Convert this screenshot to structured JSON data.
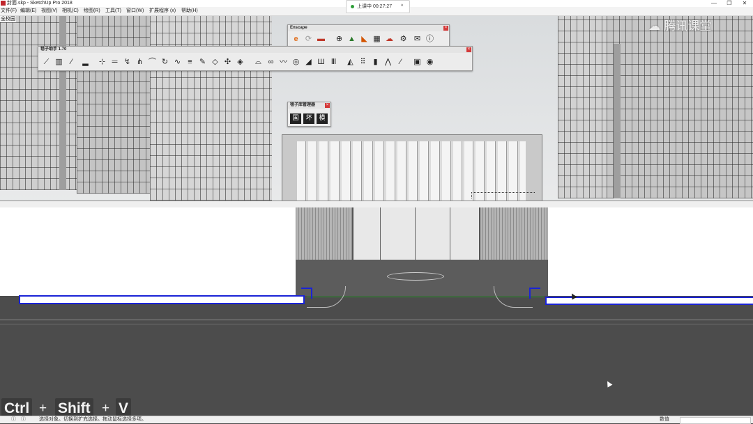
{
  "window": {
    "title": "封面.skp - SketchUp Pro 2018",
    "controls": [
      "—",
      "❐",
      "✕"
    ]
  },
  "menu": [
    "文件(F)",
    "编辑(E)",
    "视图(V)",
    "相机(C)",
    "绘图(R)",
    "工具(T)",
    "窗口(W)",
    "扩展程序 (x)",
    "帮助(H)"
  ],
  "class_timer": {
    "label": "上课中 00:27:27",
    "chevron": "^"
  },
  "scene_label": "全校园",
  "watermark": "腾讯课堂",
  "enscape": {
    "title": "Enscape"
  },
  "helper": {
    "title": "毯子助手 1.70"
  },
  "library": {
    "title": "毯子库管理器",
    "buttons": [
      "国",
      "坏",
      "模"
    ]
  },
  "shortcut": {
    "keys": [
      "Ctrl",
      "Shift",
      "V"
    ],
    "plus": "+"
  },
  "status": {
    "message": "选择对象。切换到扩充选择。拖动鼠标选择多项。",
    "measure_label": "数值"
  },
  "colors": {
    "selection_blue": "#1a23d6",
    "green_axis": "#2a9a2a",
    "close_red": "#d43a3a"
  }
}
